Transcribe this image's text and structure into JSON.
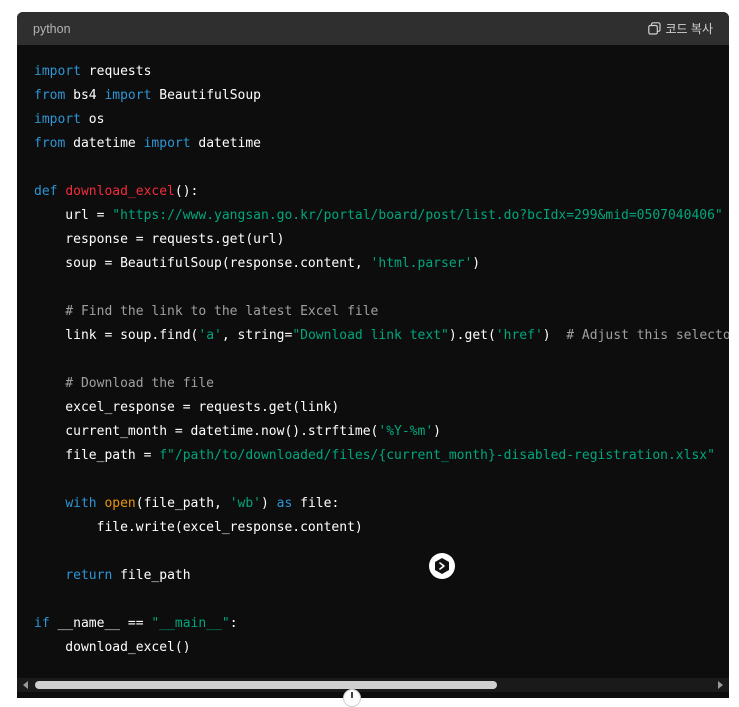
{
  "header": {
    "language": "python",
    "copy_label": "코드 복사",
    "copy_icon": "copy-icon"
  },
  "code": {
    "l1": {
      "a": "import",
      "b": " requests"
    },
    "l2": {
      "a": "from",
      "b": " bs4 ",
      "c": "import",
      "d": " BeautifulSoup"
    },
    "l3": {
      "a": "import",
      "b": " os"
    },
    "l4": {
      "a": "from",
      "b": " datetime ",
      "c": "import",
      "d": " datetime"
    },
    "l6": {
      "a": "def",
      "b": " ",
      "c": "download_excel",
      "d": "():"
    },
    "l7": {
      "a": "    url = ",
      "b": "\"https://www.yangsan.go.kr/portal/board/post/list.do?bcIdx=299&mid=0507040406\""
    },
    "l8": {
      "a": "    response = requests.get(url)"
    },
    "l9": {
      "a": "    soup = BeautifulSoup(response.content, ",
      "b": "'html.parser'",
      "c": ")"
    },
    "l11": {
      "a": "    # Find the link to the latest Excel file"
    },
    "l12": {
      "a": "    link = soup.find(",
      "b": "'a'",
      "c": ", string=",
      "d": "\"Download link text\"",
      "e": ").get(",
      "f": "'href'",
      "g": ")  ",
      "h": "# Adjust this selector"
    },
    "l14": {
      "a": "    # Download the file"
    },
    "l15": {
      "a": "    excel_response = requests.get(link)"
    },
    "l16": {
      "a": "    current_month = datetime.now().strftime(",
      "b": "'%Y-%m'",
      "c": ")"
    },
    "l17": {
      "a": "    file_path = ",
      "b": "f\"/path/to/downloaded/files/{current_month}-disabled-registration.xlsx\""
    },
    "l19": {
      "a": "    ",
      "b": "with",
      "c": " ",
      "d": "open",
      "e": "(file_path, ",
      "f": "'wb'",
      "g": ") ",
      "h": "as",
      "i": " file:"
    },
    "l20": {
      "a": "        file.write(excel_response.content)"
    },
    "l22": {
      "a": "    ",
      "b": "return",
      "c": " file_path"
    },
    "l24": {
      "a": "if",
      "b": " __name__ == ",
      "c": "\"__main__\"",
      "d": ":"
    },
    "l25": {
      "a": "    download_excel()"
    }
  },
  "icons": {
    "floating": "assistant-icon",
    "scroll_down": "arrow-down-icon"
  },
  "colors": {
    "keyword": "#2e95d3",
    "function": "#f22c3d",
    "string": "#00a67d",
    "comment": "#a0a0a0",
    "builtin": "#e9950c",
    "background": "#0d0d0d",
    "header": "#2f2f2f"
  }
}
